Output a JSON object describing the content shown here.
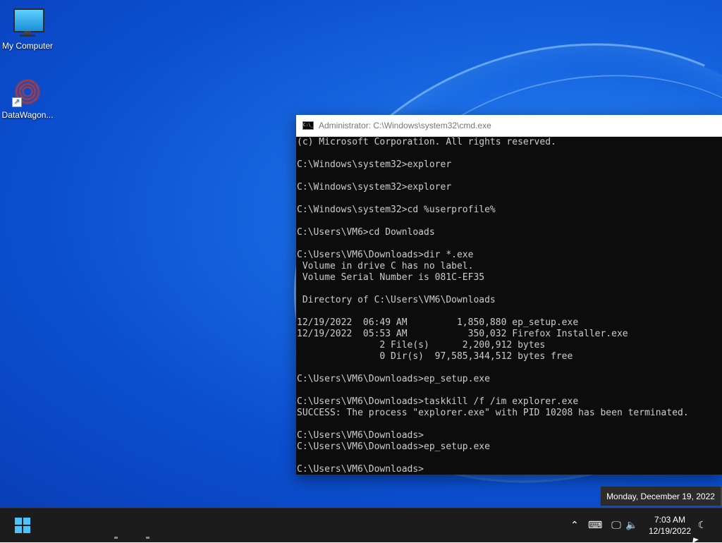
{
  "desktop": {
    "icons": [
      {
        "label": "My Computer",
        "icon": "monitor-icon"
      },
      {
        "label": "DataWagon...",
        "icon": "datawagon-icon"
      }
    ]
  },
  "cmd_window": {
    "title": "Administrator: C:\\Windows\\system32\\cmd.exe",
    "icon_text": "C:\\_",
    "lines": [
      "(c) Microsoft Corporation. All rights reserved.",
      "",
      "C:\\Windows\\system32>explorer",
      "",
      "C:\\Windows\\system32>explorer",
      "",
      "C:\\Windows\\system32>cd %userprofile%",
      "",
      "C:\\Users\\VM6>cd Downloads",
      "",
      "C:\\Users\\VM6\\Downloads>dir *.exe",
      " Volume in drive C has no label.",
      " Volume Serial Number is 081C-EF35",
      "",
      " Directory of C:\\Users\\VM6\\Downloads",
      "",
      "12/19/2022  06:49 AM         1,850,880 ep_setup.exe",
      "12/19/2022  05:53 AM           350,032 Firefox Installer.exe",
      "               2 File(s)      2,200,912 bytes",
      "               0 Dir(s)  97,585,344,512 bytes free",
      "",
      "C:\\Users\\VM6\\Downloads>ep_setup.exe",
      "",
      "C:\\Users\\VM6\\Downloads>taskkill /f /im explorer.exe",
      "SUCCESS: The process \"explorer.exe\" with PID 10208 has been terminated.",
      "",
      "C:\\Users\\VM6\\Downloads>",
      "C:\\Users\\VM6\\Downloads>ep_setup.exe",
      "",
      "C:\\Users\\VM6\\Downloads>"
    ]
  },
  "taskbar": {
    "start_icon": "windows-logo-icon",
    "tray_icons": [
      "chevron-up-icon",
      "keyboard-icon",
      "network-icon",
      "volume-icon",
      "notification-moon-icon"
    ],
    "clock": {
      "time": "7:03 AM",
      "date": "12/19/2022"
    },
    "tooltip": "Monday, December 19, 2022",
    "accent": "#4cc2ff"
  }
}
